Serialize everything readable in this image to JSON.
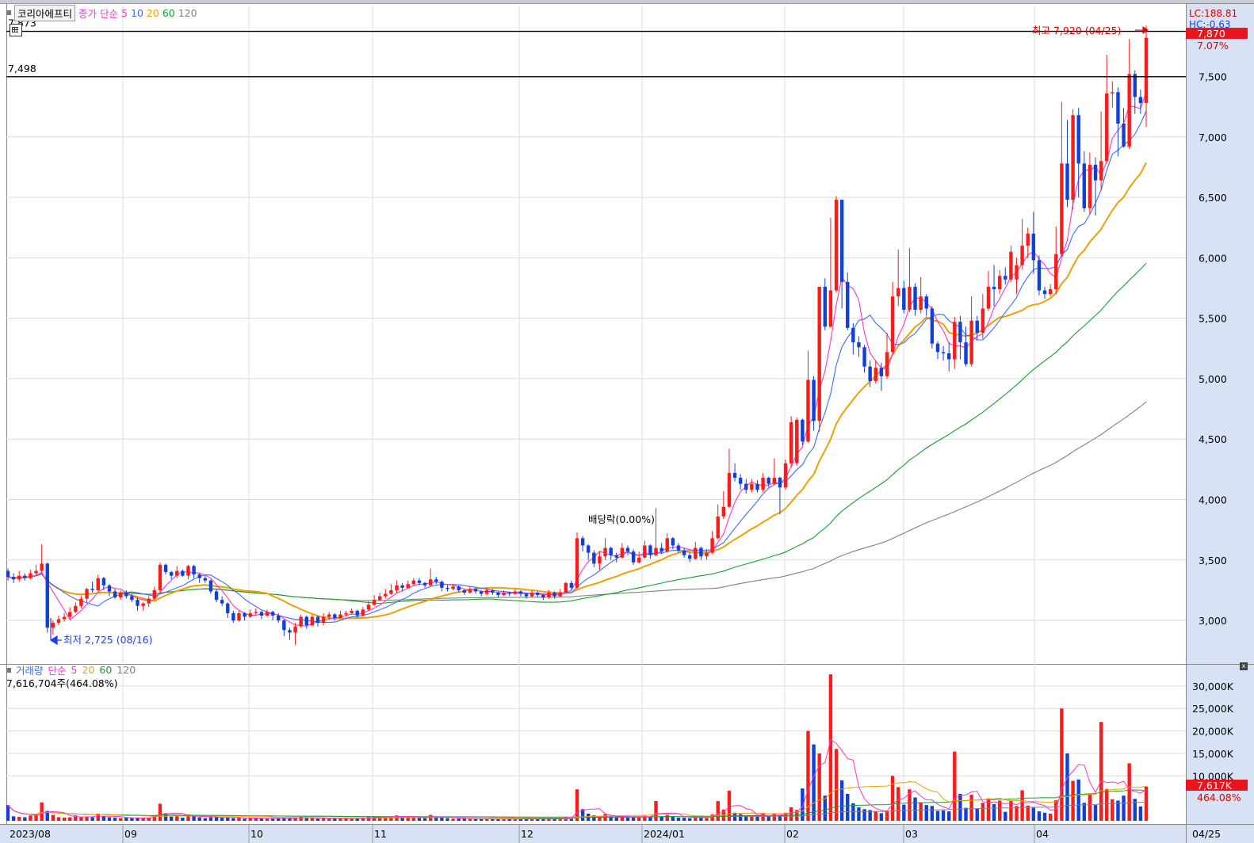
{
  "title": {
    "stock_name": "코리아에프티",
    "price_legend": [
      "종가",
      "단순",
      "5",
      "10",
      "20",
      "60",
      "120"
    ]
  },
  "colors": {
    "up": "#ff1a1a",
    "down": "#1040d8",
    "ma5": "#ff33cc",
    "ma10": "#3a6bff",
    "ma20": "#f0a000",
    "ma60": "#14a028",
    "ma120": "#808080",
    "axis_bg": "#d7e3f4"
  },
  "price_panel": {
    "y_ticks": [
      "7,500",
      "7,000",
      "6,500",
      "6,000",
      "5,500",
      "5,000",
      "4,500",
      "4,000",
      "3,500",
      "3,000"
    ],
    "hlines": [
      {
        "label": "7,873",
        "value": 7873
      },
      {
        "label": "7,498",
        "value": 7498
      }
    ],
    "lc": "LC:188.81",
    "hc": "HC:-0.63",
    "current_price": "7,870",
    "change_pct": "7.07%",
    "high_label": "최고 7,920 (04/25)",
    "low_label": "최저 2,725 (08/16)",
    "ex_dividend_label": "배당락(0.00%)"
  },
  "volume_panel": {
    "legend": [
      "거래량",
      "단순",
      "5",
      "20",
      "60",
      "120"
    ],
    "value_label": "7,616,704주(464.08%)",
    "y_ticks": [
      "30,000K",
      "25,000K",
      "20,000K",
      "15,000K",
      "10,000K"
    ],
    "current_volume": "7,617K",
    "current_pct": "464.08%"
  },
  "x_axis": {
    "labels": [
      "2023/08",
      "09",
      "10",
      "11",
      "12",
      "2024/01",
      "02",
      "03",
      "04",
      "04/25"
    ]
  },
  "chart_data": {
    "type": "candlestick",
    "y_range": [
      2640,
      8080
    ],
    "volume_max_k": 33500,
    "candles": [
      [
        3410,
        3360,
        3430,
        3330,
        3500
      ],
      [
        3360,
        3340,
        3390,
        3310,
        1000
      ],
      [
        3340,
        3370,
        3410,
        3320,
        900
      ],
      [
        3370,
        3350,
        3390,
        3330,
        800
      ],
      [
        3350,
        3390,
        3420,
        3340,
        1200
      ],
      [
        3390,
        3410,
        3460,
        3370,
        1400
      ],
      [
        3410,
        3470,
        3630,
        3390,
        4100
      ],
      [
        3470,
        2940,
        3480,
        2900,
        2200
      ],
      [
        2940,
        2980,
        3000,
        2880,
        1300
      ],
      [
        2980,
        3010,
        3040,
        2960,
        800
      ],
      [
        3010,
        3030,
        3060,
        2990,
        700
      ],
      [
        3030,
        3070,
        3110,
        3010,
        800
      ],
      [
        3070,
        3120,
        3150,
        3060,
        1200
      ],
      [
        3120,
        3180,
        3200,
        3100,
        800
      ],
      [
        3180,
        3260,
        3270,
        3150,
        900
      ],
      [
        3260,
        3250,
        3320,
        3230,
        800
      ],
      [
        3250,
        3350,
        3380,
        3240,
        1600
      ],
      [
        3350,
        3290,
        3360,
        3250,
        1000
      ],
      [
        3290,
        3240,
        3300,
        3200,
        800
      ],
      [
        3240,
        3190,
        3260,
        3180,
        700
      ],
      [
        3190,
        3230,
        3250,
        3170,
        600
      ],
      [
        3230,
        3200,
        3250,
        3180,
        700
      ],
      [
        3200,
        3170,
        3220,
        3150,
        600
      ],
      [
        3170,
        3120,
        3190,
        3080,
        700
      ],
      [
        3120,
        3140,
        3150,
        3080,
        600
      ],
      [
        3140,
        3180,
        3200,
        3110,
        700
      ],
      [
        3180,
        3250,
        3280,
        3170,
        1100
      ],
      [
        3250,
        3460,
        3480,
        3230,
        3800
      ],
      [
        3460,
        3400,
        3470,
        3380,
        1700
      ],
      [
        3400,
        3370,
        3410,
        3340,
        900
      ],
      [
        3370,
        3410,
        3450,
        3350,
        1100
      ],
      [
        3410,
        3370,
        3420,
        3360,
        700
      ],
      [
        3370,
        3450,
        3460,
        3340,
        1400
      ],
      [
        3450,
        3380,
        3460,
        3350,
        1100
      ],
      [
        3380,
        3350,
        3390,
        3310,
        800
      ],
      [
        3350,
        3330,
        3370,
        3310,
        600
      ],
      [
        3330,
        3240,
        3340,
        3220,
        800
      ],
      [
        3240,
        3170,
        3260,
        3150,
        900
      ],
      [
        3170,
        3140,
        3200,
        3120,
        700
      ],
      [
        3140,
        3060,
        3150,
        3020,
        800
      ],
      [
        3060,
        3000,
        3080,
        2980,
        600
      ],
      [
        3000,
        3060,
        3080,
        2990,
        700
      ],
      [
        3060,
        3030,
        3070,
        3000,
        500
      ],
      [
        3030,
        3060,
        3090,
        3020,
        600
      ],
      [
        3060,
        3070,
        3100,
        3040,
        700
      ],
      [
        3070,
        3040,
        3080,
        3010,
        500
      ],
      [
        3040,
        3070,
        3090,
        3030,
        500
      ],
      [
        3070,
        3040,
        3080,
        3000,
        500
      ],
      [
        3040,
        3000,
        3060,
        2980,
        600
      ],
      [
        3000,
        2920,
        3010,
        2870,
        800
      ],
      [
        2920,
        2900,
        2940,
        2840,
        600
      ],
      [
        2900,
        2950,
        2980,
        2800,
        700
      ],
      [
        2950,
        3030,
        3050,
        2940,
        900
      ],
      [
        3030,
        2960,
        3040,
        2930,
        600
      ],
      [
        2960,
        3030,
        3050,
        2950,
        700
      ],
      [
        3030,
        2980,
        3040,
        2950,
        500
      ],
      [
        2980,
        3030,
        3060,
        2960,
        600
      ],
      [
        3030,
        3050,
        3070,
        3010,
        500
      ],
      [
        3050,
        3020,
        3060,
        3000,
        500
      ],
      [
        3020,
        3050,
        3080,
        3010,
        600
      ],
      [
        3050,
        3060,
        3080,
        3030,
        500
      ],
      [
        3060,
        3080,
        3100,
        3050,
        500
      ],
      [
        3080,
        3040,
        3090,
        3020,
        500
      ],
      [
        3040,
        3090,
        3110,
        3030,
        700
      ],
      [
        3090,
        3130,
        3160,
        3080,
        800
      ],
      [
        3130,
        3170,
        3210,
        3120,
        900
      ],
      [
        3170,
        3200,
        3230,
        3160,
        800
      ],
      [
        3200,
        3220,
        3260,
        3180,
        900
      ],
      [
        3220,
        3250,
        3300,
        3210,
        1000
      ],
      [
        3250,
        3290,
        3330,
        3230,
        1200
      ],
      [
        3290,
        3270,
        3310,
        3240,
        800
      ],
      [
        3270,
        3300,
        3330,
        3260,
        800
      ],
      [
        3300,
        3330,
        3350,
        3290,
        900
      ],
      [
        3330,
        3310,
        3350,
        3290,
        700
      ],
      [
        3310,
        3290,
        3320,
        3270,
        600
      ],
      [
        3290,
        3340,
        3430,
        3280,
        1300
      ],
      [
        3340,
        3320,
        3360,
        3300,
        800
      ],
      [
        3320,
        3270,
        3330,
        3240,
        700
      ],
      [
        3270,
        3260,
        3290,
        3240,
        600
      ],
      [
        3260,
        3280,
        3300,
        3250,
        500
      ],
      [
        3280,
        3250,
        3290,
        3230,
        500
      ],
      [
        3250,
        3230,
        3260,
        3210,
        500
      ],
      [
        3230,
        3260,
        3280,
        3220,
        500
      ],
      [
        3260,
        3240,
        3270,
        3220,
        400
      ],
      [
        3240,
        3220,
        3250,
        3200,
        400
      ],
      [
        3220,
        3250,
        3270,
        3210,
        400
      ],
      [
        3250,
        3230,
        3260,
        3210,
        400
      ],
      [
        3230,
        3210,
        3240,
        3190,
        400
      ],
      [
        3210,
        3230,
        3250,
        3200,
        400
      ],
      [
        3230,
        3220,
        3240,
        3200,
        400
      ],
      [
        3220,
        3240,
        3260,
        3210,
        400
      ],
      [
        3240,
        3220,
        3250,
        3200,
        400
      ],
      [
        3220,
        3200,
        3230,
        3180,
        400
      ],
      [
        3200,
        3230,
        3250,
        3190,
        400
      ],
      [
        3230,
        3210,
        3240,
        3190,
        400
      ],
      [
        3210,
        3190,
        3220,
        3170,
        400
      ],
      [
        3190,
        3230,
        3250,
        3180,
        500
      ],
      [
        3230,
        3200,
        3240,
        3180,
        400
      ],
      [
        3200,
        3230,
        3260,
        3190,
        500
      ],
      [
        3230,
        3310,
        3320,
        3220,
        900
      ],
      [
        3310,
        3270,
        3330,
        3250,
        700
      ],
      [
        3270,
        3680,
        3730,
        3260,
        7000
      ],
      [
        3680,
        3620,
        3700,
        3570,
        2600
      ],
      [
        3620,
        3560,
        3630,
        3500,
        1600
      ],
      [
        3560,
        3470,
        3580,
        3440,
        1200
      ],
      [
        3470,
        3530,
        3570,
        3420,
        1000
      ],
      [
        3530,
        3600,
        3680,
        3500,
        1500
      ],
      [
        3600,
        3540,
        3610,
        3500,
        900
      ],
      [
        3540,
        3520,
        3560,
        3480,
        700
      ],
      [
        3520,
        3600,
        3640,
        3510,
        1000
      ],
      [
        3600,
        3570,
        3620,
        3540,
        700
      ],
      [
        3570,
        3480,
        3590,
        3460,
        800
      ],
      [
        3480,
        3520,
        3570,
        3470,
        900
      ],
      [
        3520,
        3620,
        3660,
        3510,
        1100
      ],
      [
        3620,
        3540,
        3630,
        3510,
        800
      ],
      [
        3540,
        3600,
        3930,
        3530,
        4400
      ],
      [
        3600,
        3570,
        3640,
        3550,
        900
      ],
      [
        3570,
        3680,
        3720,
        3560,
        1300
      ],
      [
        3680,
        3620,
        3690,
        3590,
        900
      ],
      [
        3620,
        3580,
        3640,
        3560,
        700
      ],
      [
        3580,
        3540,
        3600,
        3520,
        700
      ],
      [
        3540,
        3510,
        3560,
        3480,
        600
      ],
      [
        3510,
        3600,
        3650,
        3500,
        900
      ],
      [
        3600,
        3530,
        3610,
        3500,
        700
      ],
      [
        3530,
        3560,
        3590,
        3500,
        600
      ],
      [
        3560,
        3680,
        3740,
        3550,
        1400
      ],
      [
        3680,
        3860,
        3960,
        3670,
        4400
      ],
      [
        3860,
        3940,
        4070,
        3840,
        2500
      ],
      [
        3940,
        4220,
        4420,
        3930,
        6700
      ],
      [
        4220,
        4180,
        4300,
        4150,
        1800
      ],
      [
        4180,
        4130,
        4210,
        4080,
        1500
      ],
      [
        4130,
        4080,
        4170,
        4050,
        1100
      ],
      [
        4080,
        4130,
        4170,
        4060,
        1100
      ],
      [
        4130,
        4080,
        4160,
        4060,
        1000
      ],
      [
        4080,
        4180,
        4220,
        4060,
        1600
      ],
      [
        4180,
        4130,
        4190,
        4100,
        1000
      ],
      [
        4130,
        4180,
        4340,
        4120,
        1500
      ],
      [
        4180,
        4100,
        4190,
        3880,
        1300
      ],
      [
        4100,
        4300,
        4330,
        4080,
        1800
      ],
      [
        4300,
        4640,
        4690,
        4270,
        3000
      ],
      [
        4300,
        4660,
        4680,
        4280,
        2400
      ],
      [
        4660,
        4480,
        4670,
        4450,
        7200
      ],
      [
        4480,
        4990,
        5230,
        4470,
        20000
      ],
      [
        4990,
        4650,
        5020,
        4570,
        17000
      ],
      [
        4650,
        5760,
        5620,
        4560,
        15000
      ],
      [
        5760,
        5430,
        5830,
        5400,
        5600
      ],
      [
        5430,
        5730,
        6330,
        5420,
        32600
      ],
      [
        5730,
        6480,
        6510,
        5710,
        16000
      ],
      [
        6480,
        5800,
        6420,
        5580,
        9000
      ],
      [
        5800,
        5420,
        5880,
        5400,
        6000
      ],
      [
        5420,
        5300,
        5460,
        5200,
        3900
      ],
      [
        5300,
        5260,
        5350,
        5180,
        3000
      ],
      [
        5260,
        5100,
        5280,
        5050,
        2600
      ],
      [
        5100,
        4980,
        5150,
        4930,
        2400
      ],
      [
        4980,
        5090,
        5150,
        4960,
        2000
      ],
      [
        5090,
        5020,
        5130,
        4900,
        1700
      ],
      [
        5020,
        5220,
        5380,
        5000,
        2200
      ],
      [
        5220,
        5680,
        5800,
        5200,
        10000
      ],
      [
        5680,
        5750,
        6070,
        5600,
        7500
      ],
      [
        5750,
        5570,
        5810,
        5540,
        3600
      ],
      [
        5570,
        5760,
        6080,
        5550,
        7000
      ],
      [
        5760,
        5570,
        5790,
        5520,
        5200
      ],
      [
        5570,
        5680,
        5840,
        5540,
        4100
      ],
      [
        5680,
        5580,
        5700,
        5520,
        3500
      ],
      [
        5580,
        5290,
        5600,
        5250,
        3300
      ],
      [
        5290,
        5220,
        5310,
        5160,
        2200
      ],
      [
        5220,
        5210,
        5270,
        5150,
        2300
      ],
      [
        5210,
        5160,
        5300,
        5060,
        2100
      ],
      [
        5160,
        5470,
        5510,
        5080,
        15400
      ],
      [
        5470,
        5300,
        5520,
        5160,
        6000
      ],
      [
        5300,
        5120,
        5430,
        5100,
        2900
      ],
      [
        5120,
        5480,
        5680,
        5100,
        5800
      ],
      [
        5480,
        5380,
        5520,
        5320,
        2700
      ],
      [
        5380,
        5580,
        5700,
        5330,
        4000
      ],
      [
        5580,
        5760,
        5890,
        5560,
        5000
      ],
      [
        5760,
        5740,
        5940,
        5600,
        3700
      ],
      [
        5740,
        5850,
        5900,
        5700,
        4500
      ],
      [
        5850,
        5820,
        5920,
        5780,
        2000
      ],
      [
        5820,
        6050,
        6100,
        5800,
        4400
      ],
      [
        5820,
        5940,
        6000,
        5700,
        3300
      ],
      [
        5940,
        6100,
        6320,
        5900,
        6800
      ],
      [
        6100,
        6200,
        6250,
        6000,
        3400
      ],
      [
        6200,
        5980,
        6380,
        5870,
        2900
      ],
      [
        5980,
        5730,
        6020,
        5690,
        2100
      ],
      [
        5730,
        5700,
        5760,
        5660,
        1800
      ],
      [
        5700,
        5740,
        5780,
        5680,
        1600
      ],
      [
        5740,
        6030,
        6260,
        5700,
        4600
      ],
      [
        6030,
        6780,
        7290,
        6010,
        25000
      ],
      [
        6780,
        6480,
        7140,
        6420,
        15000
      ],
      [
        6480,
        7180,
        7230,
        6400,
        8900
      ],
      [
        7180,
        6780,
        7240,
        6500,
        9200
      ],
      [
        6780,
        6410,
        6880,
        6380,
        4000
      ],
      [
        6410,
        6770,
        6870,
        6360,
        5900
      ],
      [
        6770,
        6640,
        6830,
        6350,
        3500
      ],
      [
        6640,
        6800,
        7210,
        6560,
        22000
      ],
      [
        6800,
        7360,
        7680,
        6780,
        7100
      ],
      [
        7360,
        7370,
        7460,
        7240,
        4800
      ],
      [
        7370,
        7110,
        7410,
        6840,
        4500
      ],
      [
        7110,
        6920,
        7240,
        6910,
        5600
      ],
      [
        6920,
        7520,
        7810,
        6900,
        12800
      ],
      [
        7520,
        7330,
        7550,
        7190,
        4900
      ],
      [
        7330,
        7280,
        7390,
        7190,
        3200
      ],
      [
        7280,
        7820,
        7920,
        7080,
        7617
      ]
    ],
    "ma_series": [
      "ma5",
      "ma10",
      "ma20",
      "ma60",
      "ma120"
    ]
  }
}
